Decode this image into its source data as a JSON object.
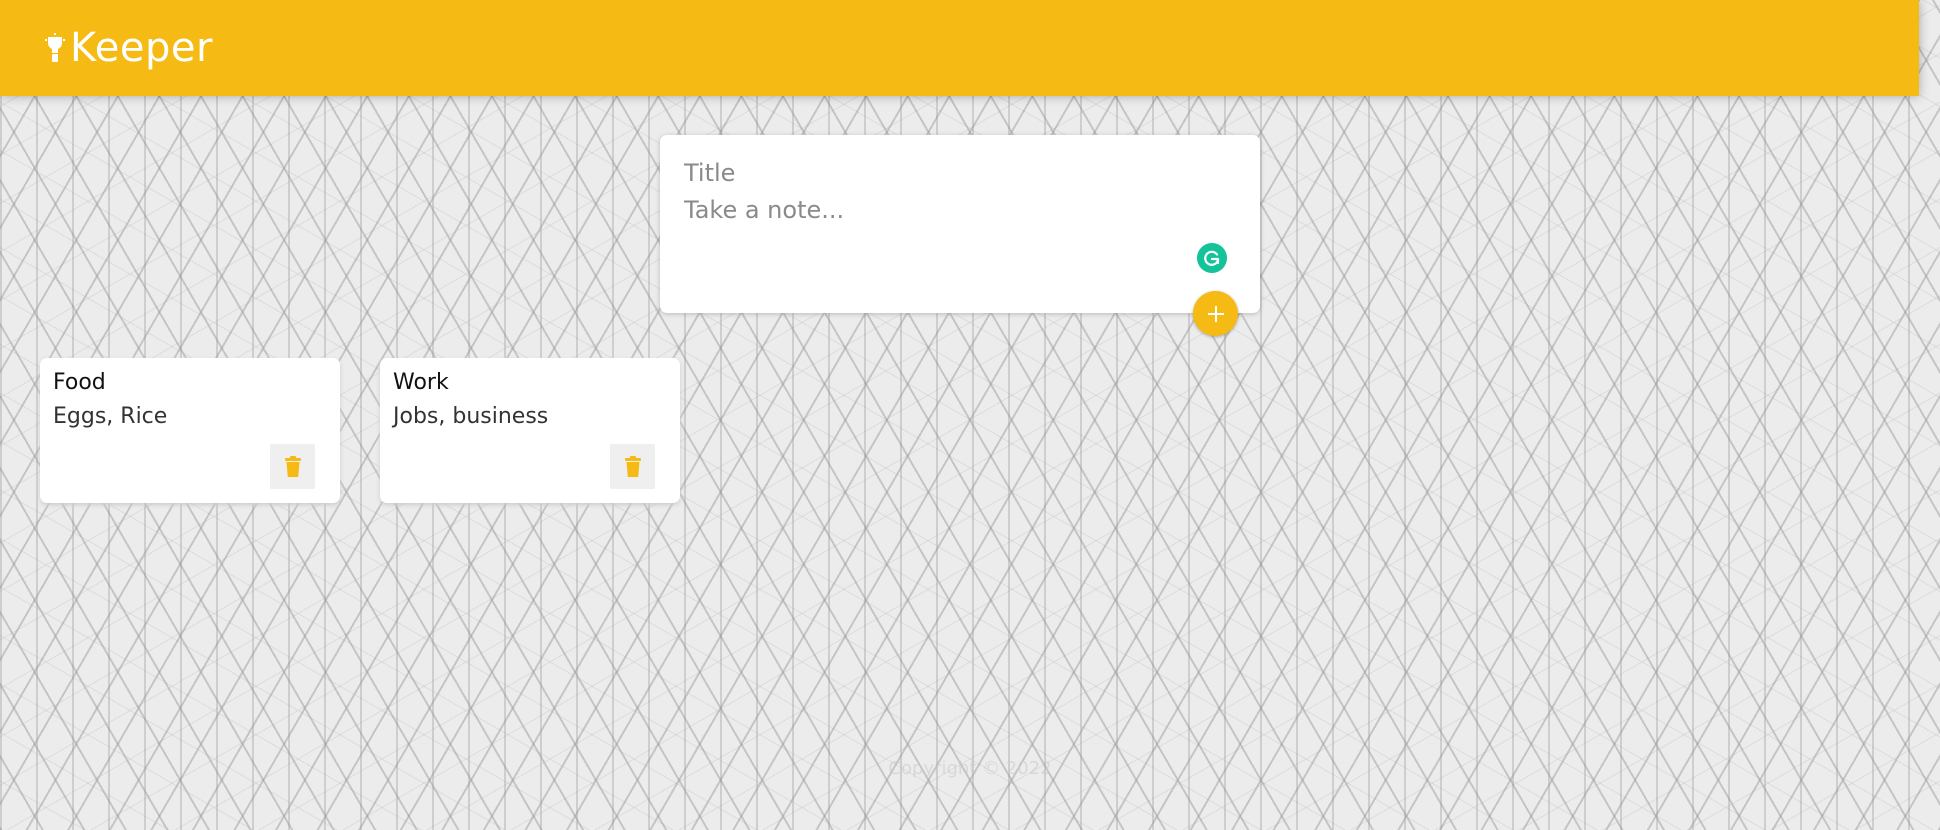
{
  "header": {
    "app_title": "Keeper",
    "logo_icon": "lightbulb-icon",
    "color": "#f5ba13"
  },
  "create_note": {
    "title_placeholder": "Title",
    "content_placeholder": "Take a note...",
    "add_icon": "plus-icon",
    "grammarly_icon": "grammarly-icon"
  },
  "notes": [
    {
      "title": "Food",
      "content": "Eggs, Rice",
      "delete_icon": "trash-icon"
    },
    {
      "title": "Work",
      "content": "Jobs, business",
      "delete_icon": "trash-icon"
    }
  ],
  "footer": {
    "text": "Copyright © 2022"
  }
}
